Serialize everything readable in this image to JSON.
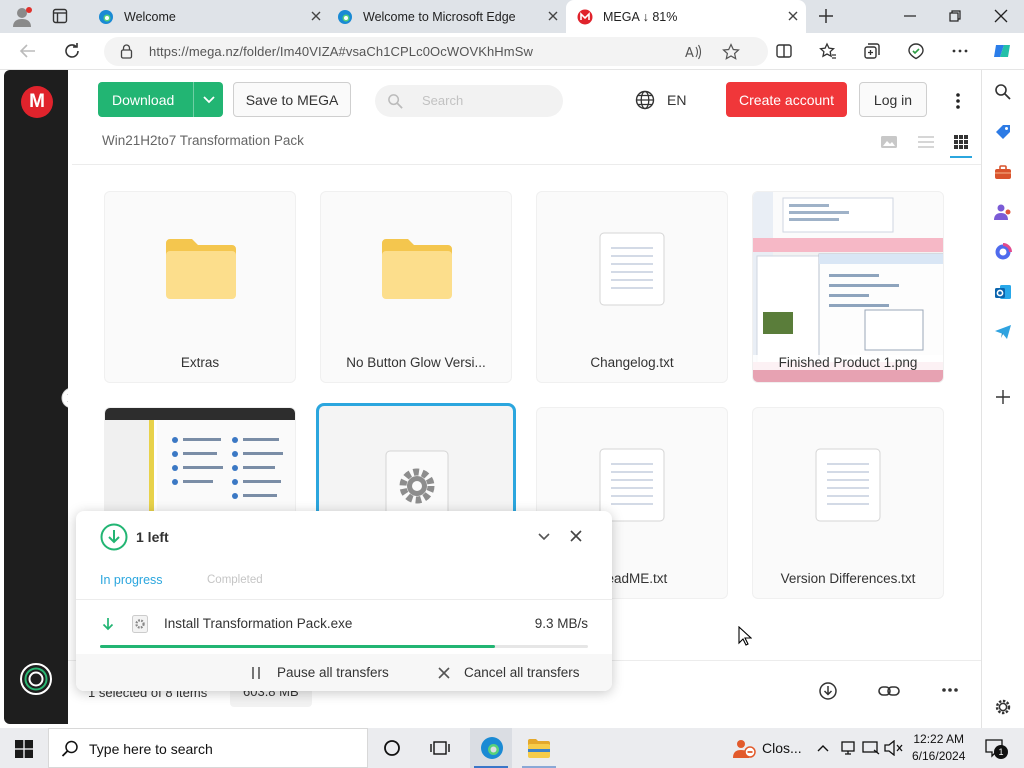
{
  "browser": {
    "tabs": [
      {
        "title": "Welcome",
        "active": false
      },
      {
        "title": "Welcome to Microsoft Edge",
        "active": false
      },
      {
        "title": "MEGA ↓ 81%",
        "active": true
      }
    ],
    "url": "https://mega.nz/folder/Im40VIZA#vsaCh1CPLc0OcWOVKhHmSw"
  },
  "mega": {
    "logo": "M",
    "header": {
      "download_label": "Download",
      "save_label": "Save to MEGA",
      "search_placeholder": "Search",
      "language": "EN",
      "create_account_label": "Create account",
      "login_label": "Log in"
    },
    "breadcrumb": "Win21H2to7 Transformation Pack",
    "items": [
      {
        "name": "Extras",
        "kind": "folder"
      },
      {
        "name": "No Button Glow Versi...",
        "kind": "folder"
      },
      {
        "name": "Changelog.txt",
        "kind": "text"
      },
      {
        "name": "Finished Product 1.png",
        "kind": "image"
      },
      {
        "name": "",
        "kind": "image"
      },
      {
        "name": "",
        "kind": "exe",
        "selected": true
      },
      {
        "name": "ReadME.txt",
        "kind": "text"
      },
      {
        "name": "Version Differences.txt",
        "kind": "text"
      }
    ],
    "bottom": {
      "selection": "1 selected of 8 items",
      "size": "603.8 MB"
    },
    "transfers": {
      "count_label": "1 left",
      "tab_in_progress": "In progress",
      "tab_completed": "Completed",
      "file_name": "Install Transformation Pack.exe",
      "speed": "9.3 MB/s",
      "progress_fraction": 0.81,
      "pause_label": "Pause all transfers",
      "cancel_label": "Cancel all transfers"
    }
  },
  "taskbar": {
    "search_placeholder": "Type here to search",
    "close_item": "Clos...",
    "time": "12:22 AM",
    "date": "6/16/2024",
    "notification_count": "1"
  },
  "colors": {
    "mega_red": "#e0232c",
    "download_green": "#22b573",
    "create_red": "#f0373a",
    "accent_blue": "#2ba6de"
  }
}
